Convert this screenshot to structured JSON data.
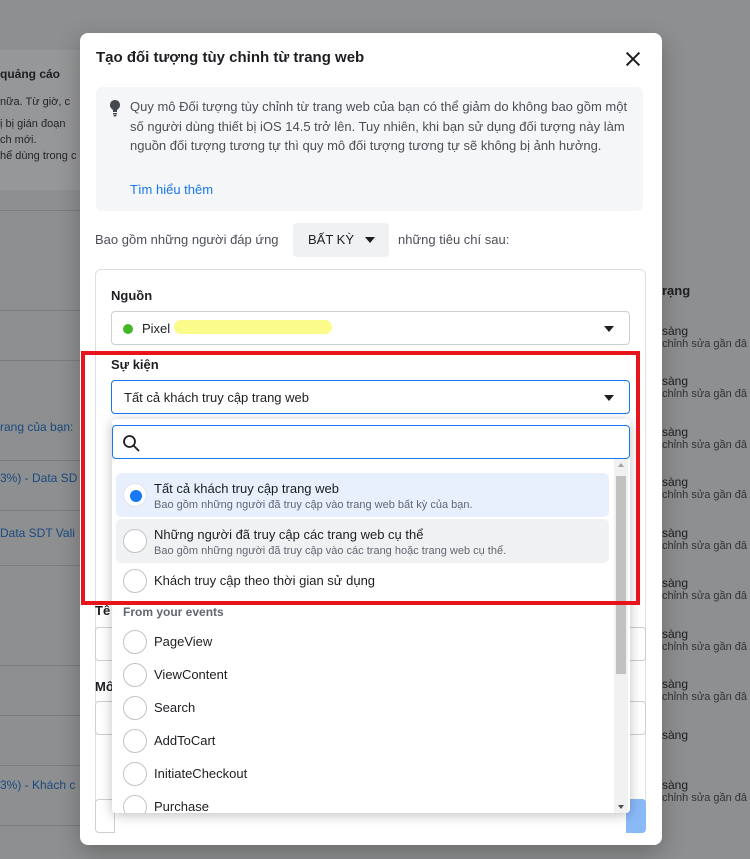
{
  "background": {
    "left_panel": {
      "title": "quảng cáo",
      "lines": [
        "nữa. Từ giờ, c",
        "ị bị gián đoạn",
        "ch mới.",
        "hể dùng trong c"
      ]
    },
    "left_links": [
      "rang của bạn:",
      "3%) - Data SD",
      "Data SDT Vali",
      "3%) - Khách c"
    ],
    "right_column_header": "rạng",
    "right_rows": [
      {
        "status": "sàng",
        "note": "chỉnh sửa gần đâ"
      },
      {
        "status": "sàng",
        "note": "chỉnh sửa gần đâ"
      },
      {
        "status": "sàng",
        "note": "chỉnh sửa gần đâ"
      },
      {
        "status": "sàng",
        "note": "chỉnh sửa gần đâ"
      },
      {
        "status": "sàng",
        "note": "chỉnh sửa gần đâ"
      },
      {
        "status": "sàng",
        "note": "chỉnh sửa gần đâ"
      },
      {
        "status": "sàng",
        "note": "chỉnh sửa gần đâ"
      },
      {
        "status": "sàng",
        "note": "chỉnh sửa gần đâ"
      },
      {
        "status": "sàng",
        "note": ""
      },
      {
        "status": "sàng",
        "note": "chỉnh sửa gần đâ"
      }
    ]
  },
  "modal": {
    "title": "Tạo đối tượng tùy chỉnh từ trang web",
    "info": {
      "icon": "lightbulb-icon",
      "text": "Quy mô Đối tượng tùy chỉnh từ trang web của bạn có thể giảm do không bao gồm một số người dùng thiết bị iOS 14.5 trở lên. Tuy nhiên, khi bạn sử dụng đối tượng này làm nguồn đối tượng tương tự thì quy mô đối tượng tương tự sẽ không bị ảnh hưởng.",
      "link": "Tìm hiểu thêm"
    },
    "include": {
      "prefix": "Bao gồm những người đáp ứng",
      "selector": "BẤT KỲ",
      "suffix": "những tiêu chí sau:"
    },
    "source": {
      "label": "Nguồn",
      "value": "Pixel"
    },
    "event": {
      "label": "Sự kiện",
      "value": "Tất cả khách truy cập trang web"
    },
    "lower_labels": [
      "Tê",
      "Mô"
    ]
  },
  "dropdown": {
    "search_placeholder": "",
    "options": [
      {
        "title": "Tất cả khách truy cập trang web",
        "desc": "Bao gồm những người đã truy cập vào trang web bất kỳ của bạn.",
        "selected": true
      },
      {
        "title": "Những người đã truy cập các trang web cụ thể",
        "desc": "Bao gồm những người đã truy cập vào các trang hoặc trang web cụ thể.",
        "selected": false
      },
      {
        "title": "Khách truy cập theo thời gian sử dụng",
        "desc": "",
        "selected": false
      }
    ],
    "group_heading": "From your events",
    "events": [
      "PageView",
      "ViewContent",
      "Search",
      "AddToCart",
      "InitiateCheckout",
      "Purchase"
    ]
  },
  "colors": {
    "accent": "#1877f2",
    "highlight": "#e8141c",
    "pixel_status": "#42b72a"
  }
}
